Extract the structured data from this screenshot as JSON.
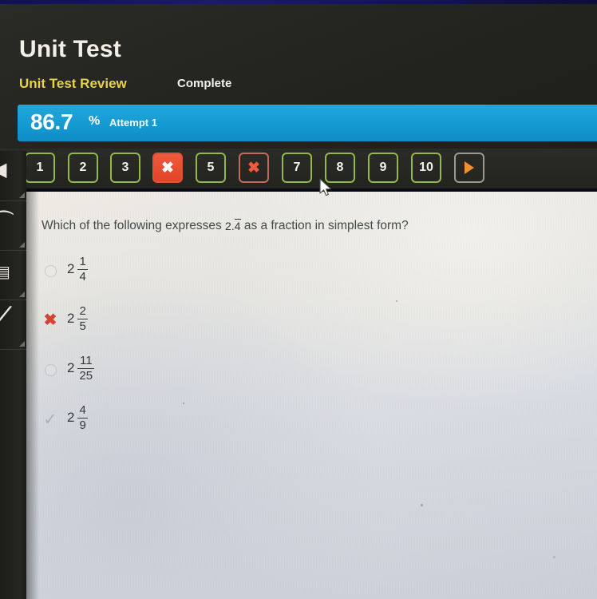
{
  "header": {
    "title": "Unit Test",
    "subtitle": "Unit Test Review",
    "status": "Complete"
  },
  "score": {
    "percent": "86.7",
    "percent_sign": "%",
    "attempt": "Attempt 1",
    "bar_color": "#149ad2"
  },
  "question_nav": {
    "prev_icon": "chevron-left-icon",
    "next_icon": "play-triangle-icon",
    "buttons": [
      {
        "label": "1",
        "state": "unanswered",
        "icon": ""
      },
      {
        "label": "2",
        "state": "unanswered",
        "icon": ""
      },
      {
        "label": "3",
        "state": "unanswered",
        "icon": ""
      },
      {
        "label": "",
        "state": "current-wrong",
        "icon": "✖"
      },
      {
        "label": "5",
        "state": "unanswered",
        "icon": ""
      },
      {
        "label": "",
        "state": "wrong",
        "icon": "✖"
      },
      {
        "label": "7",
        "state": "unanswered",
        "icon": ""
      },
      {
        "label": "8",
        "state": "unanswered",
        "icon": ""
      },
      {
        "label": "9",
        "state": "unanswered",
        "icon": ""
      },
      {
        "label": "10",
        "state": "unanswered",
        "icon": ""
      }
    ],
    "colors": {
      "unanswered_border": "#93b94a",
      "wrong_border": "#c26a5c",
      "current_fill": "#ef5b3c",
      "next_border": "#9a9a92",
      "next_arrow": "#f0902e"
    }
  },
  "question": {
    "text_before": "Which of the following expresses",
    "value_whole": "2.",
    "value_repeating": "4",
    "text_after": "as a fraction in simplest form?",
    "options": [
      {
        "whole": "2",
        "numerator": "1",
        "denominator": "4",
        "marker": "radio-empty",
        "marker_glyph": ""
      },
      {
        "whole": "2",
        "numerator": "2",
        "denominator": "5",
        "marker": "x-mark",
        "marker_glyph": "✖"
      },
      {
        "whole": "2",
        "numerator": "11",
        "denominator": "25",
        "marker": "radio-empty",
        "marker_glyph": ""
      },
      {
        "whole": "2",
        "numerator": "4",
        "denominator": "9",
        "marker": "check-mark",
        "marker_glyph": "✓"
      }
    ]
  },
  "sidebar": {
    "items": [
      {
        "icon": "chevron-left-icon",
        "glyph": "◀"
      },
      {
        "icon": "wifi-icon",
        "glyph": "◜"
      },
      {
        "icon": "calculator-icon",
        "glyph": "▤"
      },
      {
        "icon": "pencil-icon",
        "glyph": "╱"
      }
    ]
  }
}
